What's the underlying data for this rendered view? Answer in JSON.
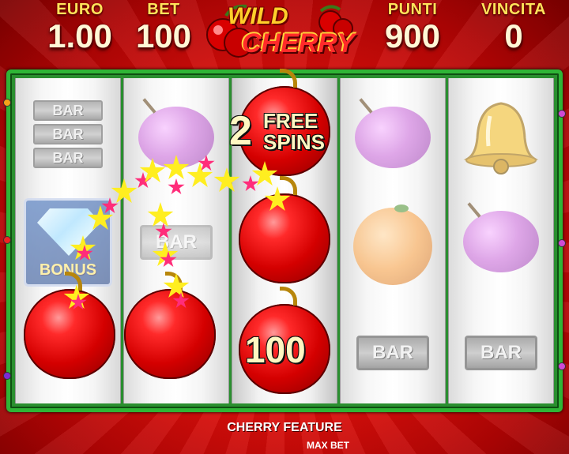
{
  "header": {
    "euro": {
      "label": "EURO",
      "value": "1.00"
    },
    "bet": {
      "label": "BET",
      "value": "100"
    },
    "punti": {
      "label": "PUNTI",
      "value": "900"
    },
    "vincita": {
      "label": "VINCITA",
      "value": "0"
    }
  },
  "logo": {
    "word1": "WILD",
    "word2": "CHERRY"
  },
  "reels": {
    "bar": "BAR",
    "bonus": "BONUS",
    "free_spins_count": "2",
    "free_spins_text": "FREE SPINS",
    "cherry_value": "100"
  },
  "footer": {
    "feature": "CHERRY FEATURE",
    "max_bet": "MAX BET"
  },
  "colors": {
    "background": "#d50f0a",
    "frame": "#2fb536",
    "label": "#ffe35a"
  }
}
